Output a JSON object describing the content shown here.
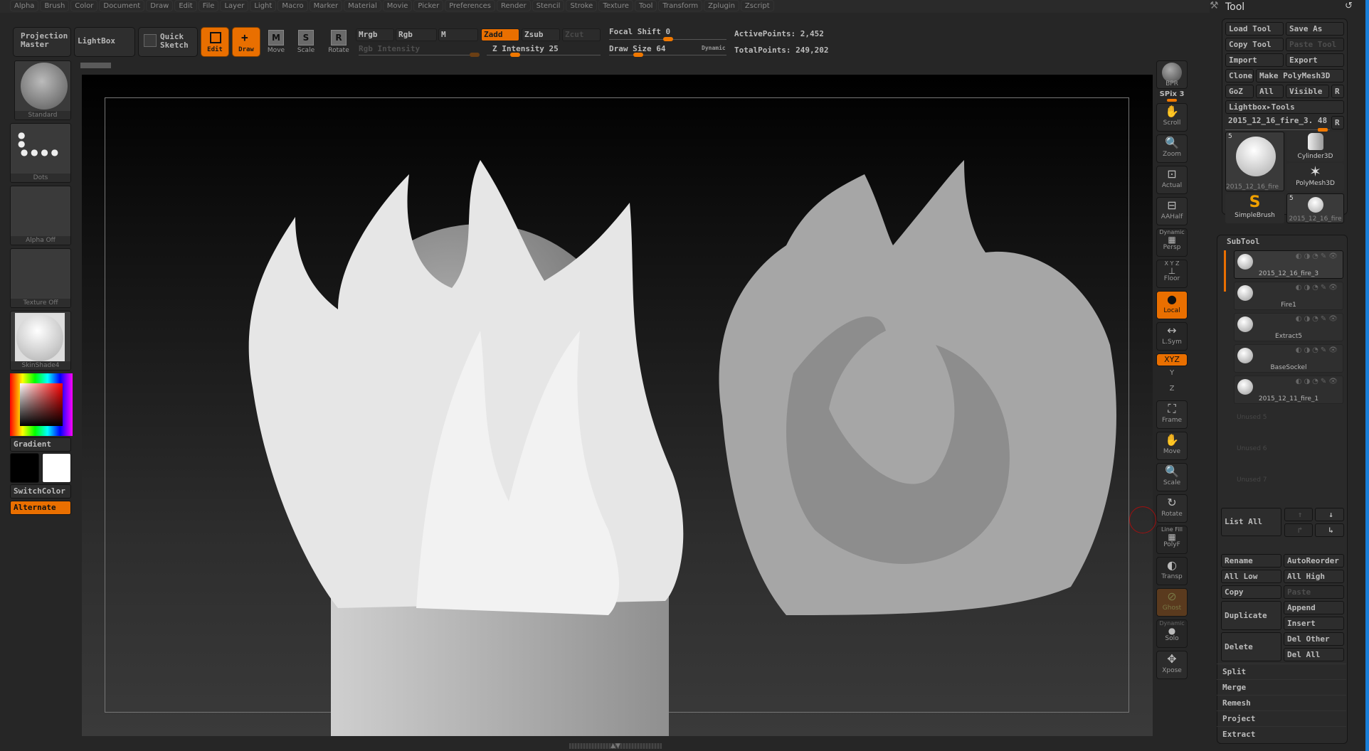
{
  "menubar": [
    "Alpha",
    "Brush",
    "Color",
    "Document",
    "Draw",
    "Edit",
    "File",
    "Layer",
    "Light",
    "Macro",
    "Marker",
    "Material",
    "Movie",
    "Picker",
    "Preferences",
    "Render",
    "Stencil",
    "Stroke",
    "Texture",
    "Tool",
    "Transform",
    "Zplugin",
    "Zscript"
  ],
  "toolbar": {
    "projection_master": "Projection Master",
    "lightbox": "LightBox",
    "quick_sketch": "Quick Sketch",
    "edit": "Edit",
    "draw": "Draw",
    "move": "Move",
    "scale": "Scale",
    "rotate": "Rotate",
    "modes": [
      {
        "label": "Mrgb",
        "state": "normal"
      },
      {
        "label": "Rgb",
        "state": "normal"
      },
      {
        "label": "M",
        "state": "normal"
      },
      {
        "label": "Zadd",
        "state": "on"
      },
      {
        "label": "Zsub",
        "state": "normal"
      },
      {
        "label": "Zcut",
        "state": "disabled"
      }
    ],
    "rgb_intensity": "Rgb Intensity",
    "z_intensity": "Z Intensity 25",
    "focal_shift": "Focal Shift 0",
    "draw_size": "Draw Size 64",
    "dynamic": "Dynamic",
    "active_points": "ActivePoints: 2,452",
    "total_points": "TotalPoints: 249,202",
    "z_intensity_value": 25,
    "focal_shift_value": 0,
    "draw_size_value": 64
  },
  "left_shelf": {
    "brush": "Standard",
    "stroke": "Dots",
    "alpha": "Alpha Off",
    "texture": "Texture Off",
    "material": "SkinShade4",
    "gradient": "Gradient",
    "switch_color": "SwitchColor",
    "alternate": "Alternate",
    "primary_color": "#000000",
    "secondary_color": "#ffffff"
  },
  "right_shelf": {
    "bpr": "BPR",
    "spix": "SPix 3",
    "buttons": [
      "Scroll",
      "Zoom",
      "Actual",
      "AAHalf",
      "Persp",
      "Floor",
      "Local",
      "L.Sym",
      "XYZ",
      "Y",
      "Z",
      "Frame",
      "Move",
      "Scale",
      "Rotate",
      "PolyF",
      "Transp",
      "Ghost",
      "Solo",
      "Xpose"
    ],
    "persp_tag": "Dynamic",
    "floor_tag": "X Y Z",
    "polyf_tag": "Line Fill",
    "solo_tag": "Dynamic"
  },
  "tool_panel": {
    "title": "Tool",
    "load_tool": "Load Tool",
    "save_as": "Save As",
    "copy_tool": "Copy Tool",
    "paste_tool": "Paste Tool",
    "import": "Import",
    "export": "Export",
    "clone": "Clone",
    "make_polymesh": "Make PolyMesh3D",
    "goz": "GoZ",
    "all": "All",
    "visible": "Visible",
    "r": "R",
    "lightbox_tools": "Lightbox▸Tools",
    "current_tool": "2015_12_16_fire_3. 48",
    "thumbs": [
      {
        "label": "2015_12_16_fire",
        "count": "5"
      },
      {
        "label": "Cylinder3D"
      },
      {
        "label": "PolyMesh3D"
      },
      {
        "label": "SimpleBrush"
      },
      {
        "label": "2015_12_16_fire",
        "count": "5"
      }
    ],
    "subtool_title": "SubTool",
    "subtools": [
      "2015_12_16_fire_3",
      "Fire1",
      "Extract5",
      "BaseSockel",
      "2015_12_11_fire_1"
    ],
    "unused": [
      "Unused 5",
      "Unused 6",
      "Unused 7"
    ],
    "list_all": "List All",
    "rename": "Rename",
    "auto_reorder": "AutoReorder",
    "all_low": "All Low",
    "all_high": "All High",
    "copy": "Copy",
    "paste": "Paste",
    "duplicate": "Duplicate",
    "append": "Append",
    "insert": "Insert",
    "delete": "Delete",
    "del_other": "Del Other",
    "del_all": "Del All",
    "sections": [
      "Split",
      "Merge",
      "Remesh",
      "Project",
      "Extract"
    ]
  }
}
